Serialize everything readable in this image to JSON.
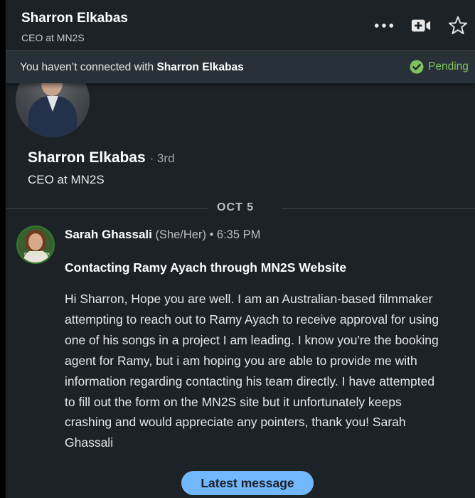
{
  "header": {
    "name": "Sharron Elkabas",
    "headline": "CEO at MN2S",
    "icons": [
      "more-icon",
      "video-call-icon",
      "star-icon"
    ]
  },
  "banner": {
    "prefix": "You haven’t connected with ",
    "name": "Sharron Elkabas",
    "status": "Pending",
    "status_color": "#7fc15e"
  },
  "profile": {
    "name": "Sharron Elkabas",
    "degree": "· 3rd",
    "headline": "CEO at MN2S"
  },
  "thread": {
    "date": "OCT 5",
    "message": {
      "sender": "Sarah Ghassali",
      "pronouns": "(She/Her)",
      "time": "• 6:35 PM",
      "avatar_badge": "OPENTOWORK",
      "subject": "Contacting Ramy Ayach through MN2S Website",
      "body": "Hi Sharron, Hope you are well. I am an Australian-based filmmaker attempting to reach out to Ramy Ayach to receive approval for using one of his songs in a project I am leading. I know you're the booking agent for Ramy, but i am hoping you are able to provide me with information regarding contacting his team directly. I have attempted to fill out the form on the MN2S site but it unfortunately keeps crashing and would appreciate any pointers, thank you! Sarah Ghassali"
    }
  },
  "latest_button": "Latest message",
  "colors": {
    "background": "#1d2226",
    "banner": "#293138",
    "accent_blue": "#71b7fb"
  }
}
